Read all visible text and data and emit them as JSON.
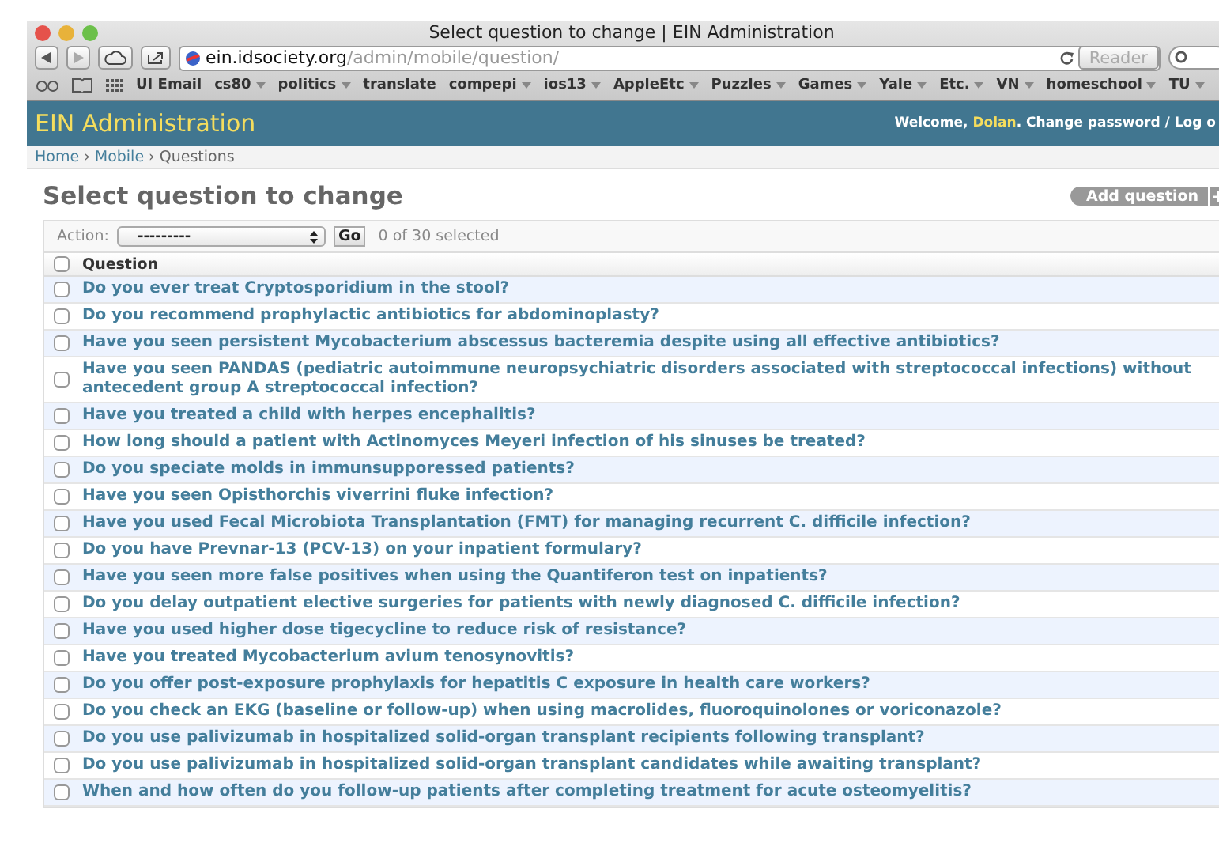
{
  "window": {
    "title": "Select question to change | EIN Administration"
  },
  "toolbar": {
    "url_domain": "ein.idsociety.org",
    "url_path": "/admin/mobile/question/",
    "reader": "Reader"
  },
  "bookmarks": [
    {
      "label": "UI Email",
      "has_menu": false
    },
    {
      "label": "cs80",
      "has_menu": true
    },
    {
      "label": "politics",
      "has_menu": true
    },
    {
      "label": "translate",
      "has_menu": false
    },
    {
      "label": "compepi",
      "has_menu": true
    },
    {
      "label": "ios13",
      "has_menu": true
    },
    {
      "label": "AppleEtc",
      "has_menu": true
    },
    {
      "label": "Puzzles",
      "has_menu": true
    },
    {
      "label": "Games",
      "has_menu": true
    },
    {
      "label": "Yale",
      "has_menu": true
    },
    {
      "label": "Etc.",
      "has_menu": true
    },
    {
      "label": "VN",
      "has_menu": true
    },
    {
      "label": "homeschool",
      "has_menu": true
    },
    {
      "label": "TU",
      "has_menu": true
    }
  ],
  "header": {
    "site_title": "EIN Administration",
    "welcome": "Welcome,",
    "user": "Dolan",
    "after_user": ".",
    "link_separator": "/",
    "user_links": [
      "Change password",
      "Log o"
    ]
  },
  "breadcrumb_separator": "›",
  "breadcrumbs": [
    "Home",
    "Mobile",
    "Questions"
  ],
  "heading": "Select question to change",
  "add_button": "Add question",
  "actions": {
    "label": "Action:",
    "value": "---------",
    "go": "Go",
    "count": "0 of 30 selected"
  },
  "table": {
    "columns": [
      "Question"
    ],
    "select_all": false,
    "rows": [
      {
        "text": "Do you ever treat Cryptosporidium in the stool?",
        "checked": false
      },
      {
        "text": "Do you recommend prophylactic antibiotics for abdominoplasty?",
        "checked": false
      },
      {
        "text": "Have you seen persistent Mycobacterium abscessus bacteremia despite using all effective antibiotics?",
        "checked": false
      },
      {
        "text": "Have you seen PANDAS (pediatric autoimmune neuropsychiatric disorders associated with streptococcal infections) without antecedent group A streptococcal infection?",
        "checked": false
      },
      {
        "text": "Have you treated a child with herpes encephalitis?",
        "checked": false
      },
      {
        "text": "How long should a patient with Actinomyces Meyeri infection of his sinuses be treated?",
        "checked": false
      },
      {
        "text": "Do you speciate molds in immunsupporessed patients?",
        "checked": false
      },
      {
        "text": "Have you seen Opisthorchis viverrini fluke infection?",
        "checked": false
      },
      {
        "text": "Have you used Fecal Microbiota Transplantation (FMT) for managing recurrent C. difficile infection?",
        "checked": false
      },
      {
        "text": "Do you have Prevnar-13 (PCV-13) on your inpatient formulary?",
        "checked": false
      },
      {
        "text": "Have you seen more false positives when using the Quantiferon test on inpatients?",
        "checked": false
      },
      {
        "text": "Do you delay outpatient elective surgeries for patients with newly diagnosed C. difficile infection?",
        "checked": false
      },
      {
        "text": "Have you used higher dose tigecycline to reduce risk of resistance?",
        "checked": false
      },
      {
        "text": "Have you treated Mycobacterium avium tenosynovitis?",
        "checked": false
      },
      {
        "text": "Do you offer post-exposure prophylaxis for hepatitis C exposure in health care workers?",
        "checked": false
      },
      {
        "text": "Do you check an EKG (baseline or follow-up) when using macrolides, fluoroquinolones or voriconazole?",
        "checked": false
      },
      {
        "text": "Do you use palivizumab in hospitalized solid-organ transplant recipients following transplant?",
        "checked": false
      },
      {
        "text": "Do you use palivizumab in hospitalized solid-organ transplant candidates while awaiting transplant?",
        "checked": false
      },
      {
        "text": "When and how often do you follow-up patients after completing treatment for acute osteomyelitis?",
        "checked": false
      }
    ]
  }
}
